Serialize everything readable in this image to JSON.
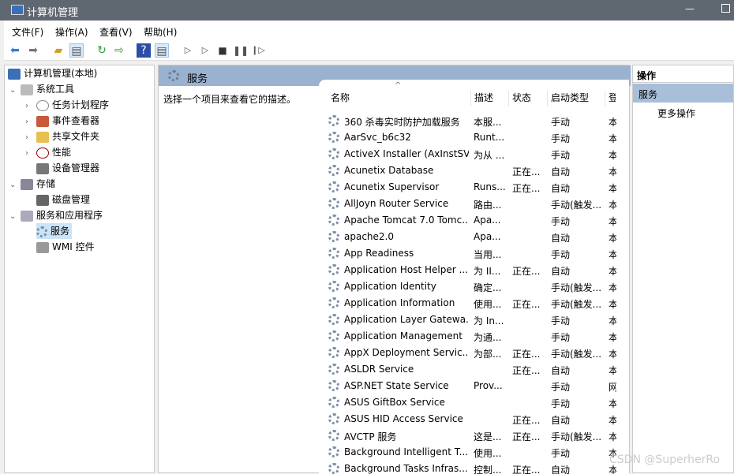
{
  "window": {
    "title": "计算机管理"
  },
  "menu": [
    "文件(F)",
    "操作(A)",
    "查看(V)",
    "帮助(H)"
  ],
  "toolbar": {
    "icons": [
      "back-icon",
      "forward-icon",
      "up-folder-icon",
      "show-hide-tree-icon",
      "refresh-icon",
      "export-icon",
      "help-icon",
      "show-action-pane-icon",
      "start-icon",
      "start-alt-icon",
      "stop-icon",
      "pause-icon",
      "resume-icon"
    ]
  },
  "tree": {
    "items": [
      {
        "label": "计算机管理(本地)",
        "level": 0
      },
      {
        "label": "系统工具",
        "level": 1,
        "expanded": true
      },
      {
        "label": "任务计划程序",
        "level": 2
      },
      {
        "label": "事件查看器",
        "level": 2
      },
      {
        "label": "共享文件夹",
        "level": 2
      },
      {
        "label": "性能",
        "level": 2
      },
      {
        "label": "设备管理器",
        "level": 2
      },
      {
        "label": "存储",
        "level": 1,
        "expanded": true
      },
      {
        "label": "磁盘管理",
        "level": 2
      },
      {
        "label": "服务和应用程序",
        "level": 1,
        "expanded": true
      },
      {
        "label": "服务",
        "level": 2,
        "selected": true
      },
      {
        "label": "WMI 控件",
        "level": 2
      }
    ]
  },
  "main": {
    "title": "服务",
    "description": "选择一个项目来查看它的描述。",
    "columns": [
      "名称",
      "描述",
      "状态",
      "启动类型",
      "登"
    ],
    "rows": [
      [
        "360 杀毒实时防护加载服务",
        "本服...",
        "",
        "手动",
        "本"
      ],
      [
        "AarSvc_b6c32",
        "Runt...",
        "",
        "手动",
        "本"
      ],
      [
        "ActiveX Installer (AxInstSV)",
        "为从 ...",
        "",
        "手动",
        "本"
      ],
      [
        "Acunetix Database",
        "",
        "正在...",
        "自动",
        "本"
      ],
      [
        "Acunetix Supervisor",
        "Runs...",
        "正在...",
        "自动",
        "本"
      ],
      [
        "AllJoyn Router Service",
        "路由...",
        "",
        "手动(触发...",
        "本"
      ],
      [
        "Apache Tomcat 7.0 Tomc...",
        "Apa...",
        "",
        "手动",
        "本"
      ],
      [
        "apache2.0",
        "Apa...",
        "",
        "自动",
        "本"
      ],
      [
        "App Readiness",
        "当用...",
        "",
        "手动",
        "本"
      ],
      [
        "Application Host Helper ...",
        "为 II...",
        "正在...",
        "自动",
        "本"
      ],
      [
        "Application Identity",
        "确定...",
        "",
        "手动(触发...",
        "本"
      ],
      [
        "Application Information",
        "使用...",
        "正在...",
        "手动(触发...",
        "本"
      ],
      [
        "Application Layer Gatewa...",
        "为 In...",
        "",
        "手动",
        "本"
      ],
      [
        "Application Management",
        "为通...",
        "",
        "手动",
        "本"
      ],
      [
        "AppX Deployment Servic...",
        "为部...",
        "正在...",
        "手动(触发...",
        "本"
      ],
      [
        "ASLDR Service",
        "",
        "正在...",
        "自动",
        "本"
      ],
      [
        "ASP.NET State Service",
        "Prov...",
        "",
        "手动",
        "网"
      ],
      [
        "ASUS GiftBox Service",
        "",
        "",
        "手动",
        "本"
      ],
      [
        "ASUS HID Access Service",
        "",
        "正在...",
        "自动",
        "本"
      ],
      [
        "AVCTP 服务",
        "这是...",
        "正在...",
        "手动(触发...",
        "本"
      ],
      [
        "Background Intelligent T...",
        "使用...",
        "",
        "手动",
        "本"
      ],
      [
        "Background Tasks Infras...",
        "控制...",
        "正在...",
        "自动",
        "本"
      ]
    ]
  },
  "actions": {
    "header": "操作",
    "section": "服务",
    "items": [
      "更多操作"
    ]
  },
  "watermark": "CSDN @SuperherRo",
  "colors": {
    "titlebar": "#5f6770",
    "pane_header": "#9ab2cf",
    "selection": "#cce4f7"
  }
}
